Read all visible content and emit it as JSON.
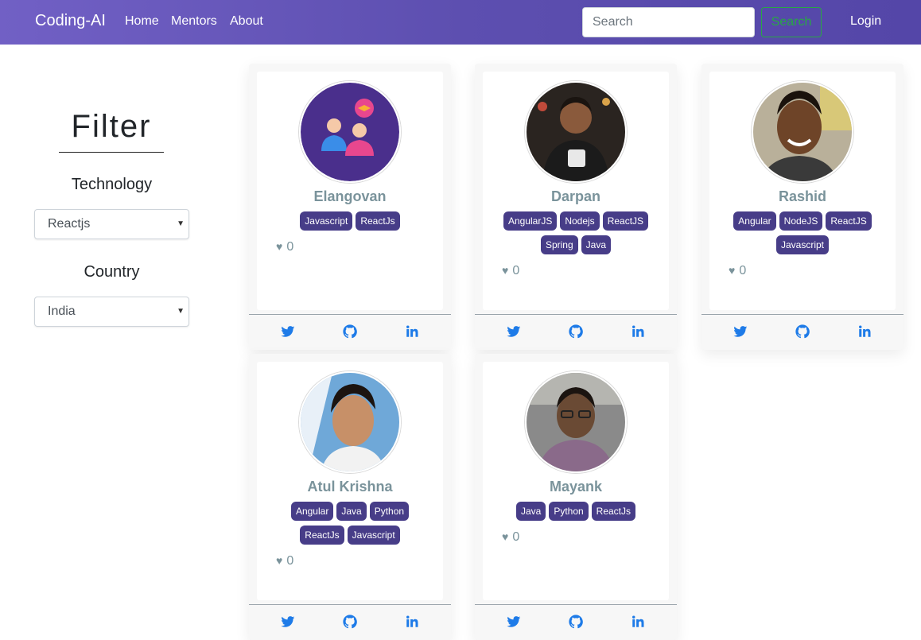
{
  "navbar": {
    "brand": "Coding-AI",
    "links": [
      "Home",
      "Mentors",
      "About"
    ],
    "search_placeholder": "Search",
    "search_button": "Search",
    "login": "Login"
  },
  "sidebar": {
    "title": "Filter",
    "technology_label": "Technology",
    "technology_value": "Reactjs",
    "country_label": "Country",
    "country_value": "India"
  },
  "mentors": [
    {
      "name": "Elangovan",
      "tags": [
        "Javascript",
        "ReactJs"
      ],
      "likes": "0"
    },
    {
      "name": "Darpan",
      "tags": [
        "AngularJS",
        "Nodejs",
        "ReactJS",
        "Spring",
        "Java"
      ],
      "likes": "0"
    },
    {
      "name": "Rashid",
      "tags": [
        "Angular",
        "NodeJS",
        "ReactJS",
        "Javascript"
      ],
      "likes": "0"
    },
    {
      "name": "Atul Krishna",
      "tags": [
        "Angular",
        "Java",
        "Python",
        "ReactJs",
        "Javascript"
      ],
      "likes": "0"
    },
    {
      "name": "Mayank",
      "tags": [
        "Java",
        "Python",
        "ReactJs"
      ],
      "likes": "0"
    }
  ],
  "colors": {
    "navbar": "#5d4fb0",
    "tag": "#473d88",
    "name": "#7a939b",
    "social": "#1e7be8",
    "search_button": "#28a745"
  },
  "icons": {
    "like": "heart-icon",
    "social": [
      "twitter-icon",
      "github-icon",
      "linkedin-icon"
    ],
    "select": "caret-down-icon"
  }
}
